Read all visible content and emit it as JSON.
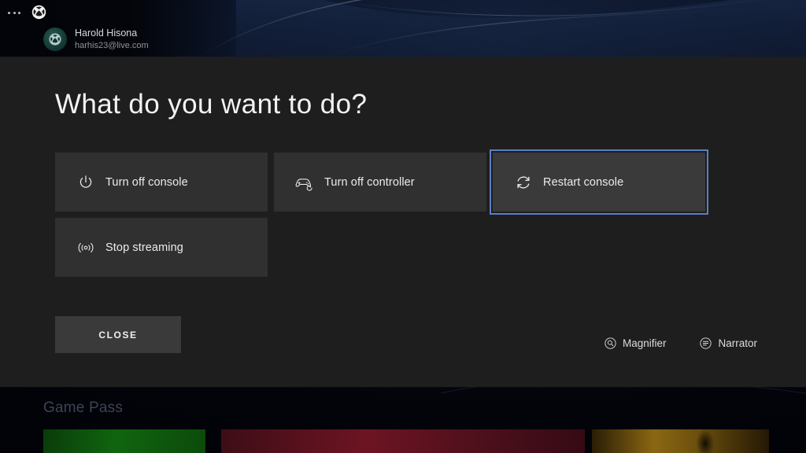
{
  "topbar": {
    "menu_icon": "ellipsis-icon",
    "xbox_icon": "xbox-logo-icon",
    "profile": {
      "avatar_icon": "xbox-avatar-icon",
      "name": "Harold Hisona",
      "email": "harhis23@live.com"
    }
  },
  "overlay": {
    "heading": "What do you want to do?",
    "options": [
      {
        "label": "Turn off console",
        "icon": "power-icon",
        "focused": false
      },
      {
        "label": "Turn off controller",
        "icon": "gamepad-icon",
        "focused": false
      },
      {
        "label": "Restart console",
        "icon": "restart-icon",
        "focused": true
      },
      {
        "label": "Stop streaming",
        "icon": "broadcast-icon",
        "focused": false
      }
    ],
    "close_label": "CLOSE",
    "accessibility": [
      {
        "label": "Magnifier",
        "icon": "magnifier-icon"
      },
      {
        "label": "Narrator",
        "icon": "narrator-icon"
      }
    ]
  },
  "background": {
    "gamepass_title": "Game Pass"
  },
  "colors": {
    "overlay_bg": "#1e1e1e",
    "tile_bg": "#303030",
    "tile_focus_bg": "#3a3a3a",
    "focus_border": "#5d7ec4",
    "text_primary": "#ececec",
    "text_secondary": "#8e939c",
    "background_navy": "#0a1225"
  }
}
